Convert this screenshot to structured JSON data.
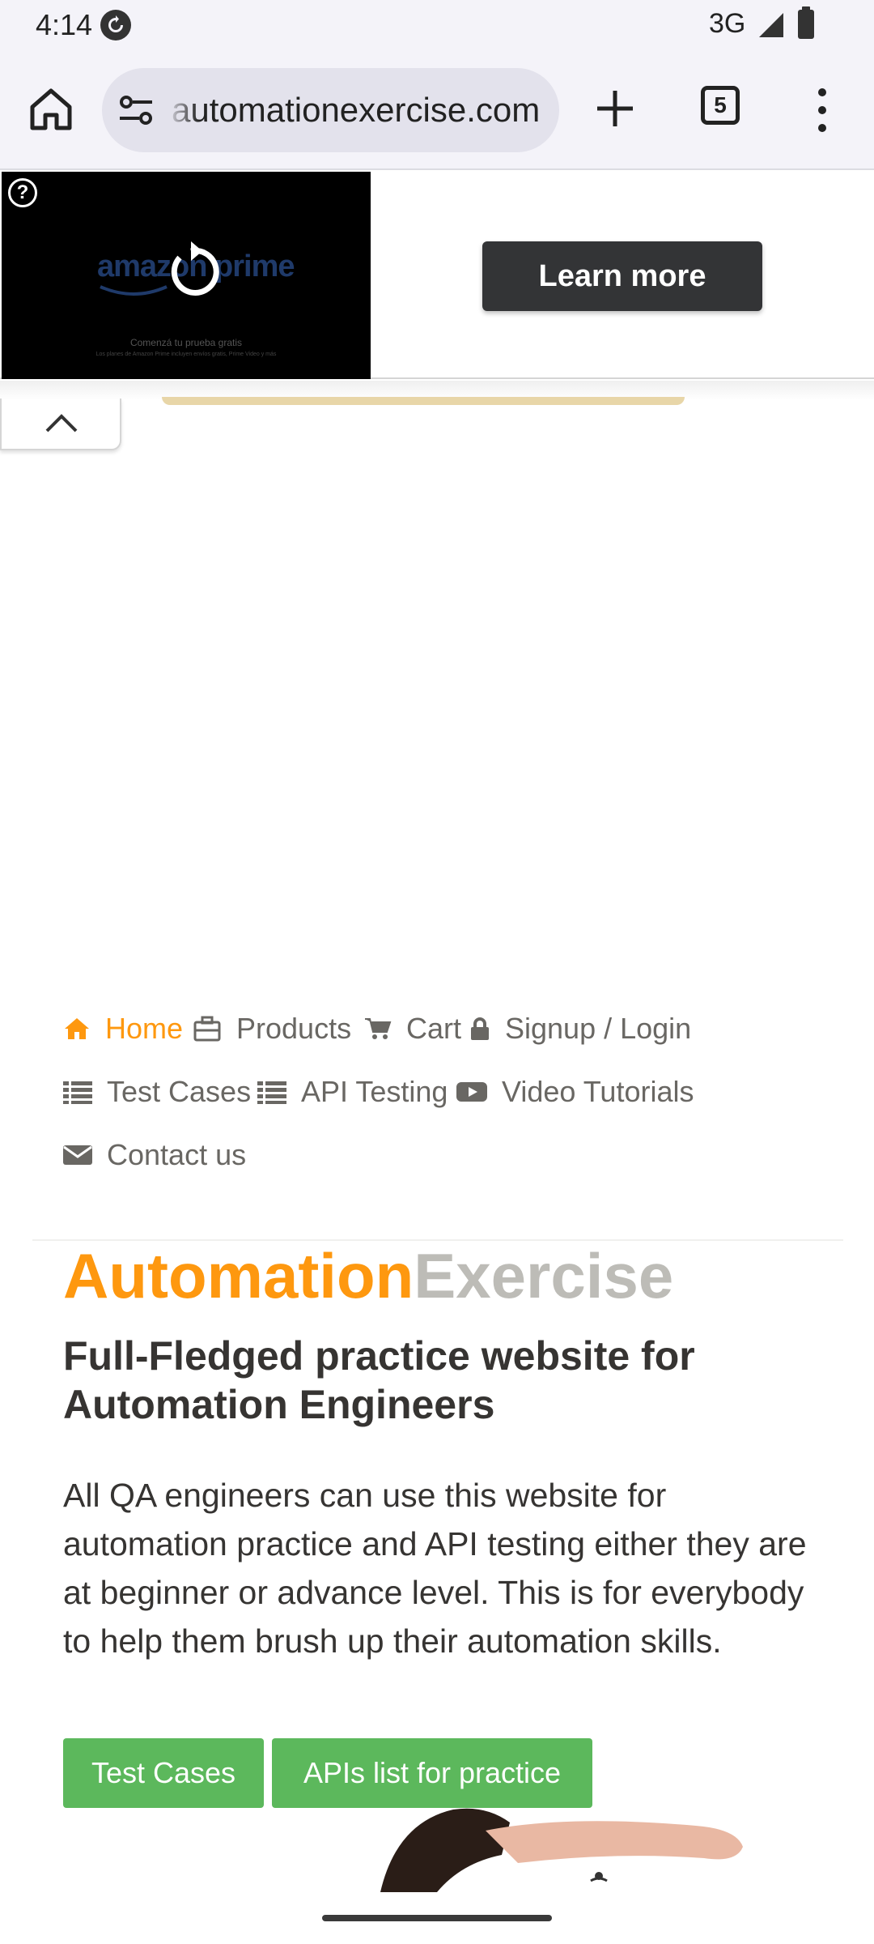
{
  "status_bar": {
    "time": "4:14",
    "network": "3G",
    "icons": [
      "sync-icon",
      "signal-icon",
      "battery-icon"
    ]
  },
  "browser": {
    "url": "automationexercise.com",
    "tab_count": "5",
    "icons": [
      "home-icon",
      "site-settings-icon",
      "new-tab-icon",
      "tab-switcher-icon",
      "more-menu-icon"
    ]
  },
  "ad": {
    "logo_text": "amazon prime",
    "fine_print": "Comenzá tu prueba gratis",
    "fine_print_small": "Los planes de Amazon Prime incluyen envíos gratis, Prime Video y más",
    "help_label": "?",
    "cta_label": "Learn more",
    "colors": {
      "cta_bg": "#333436",
      "strip": "#e8d6a8"
    }
  },
  "nav": {
    "items": [
      {
        "label": "Home",
        "icon": "home-icon",
        "active": true
      },
      {
        "label": "Products",
        "icon": "briefcase-icon"
      },
      {
        "label": "Cart",
        "icon": "cart-icon"
      },
      {
        "label": "Signup / Login",
        "icon": "lock-icon"
      },
      {
        "label": "Test Cases",
        "icon": "list-icon"
      },
      {
        "label": "API Testing",
        "icon": "list-icon"
      },
      {
        "label": "Video Tutorials",
        "icon": "youtube-icon"
      },
      {
        "label": "Contact us",
        "icon": "envelope-icon"
      }
    ],
    "colors": {
      "active": "#fe980f",
      "default": "#696763"
    }
  },
  "hero": {
    "brand_first": "Automation",
    "brand_second": "Exercise",
    "title": "Full-Fledged practice website for Automation Engineers",
    "description": "All QA engineers can use this website for automation practice and API testing either they are at beginner or advance level. This is for everybody to help them brush up their automation skills.",
    "buttons": {
      "test_cases": "Test Cases",
      "apis_list": "APIs list for practice"
    },
    "colors": {
      "brand_orange": "#fe980f",
      "brand_gray": "#bdbcb7",
      "button_green": "#5cb85c"
    }
  }
}
